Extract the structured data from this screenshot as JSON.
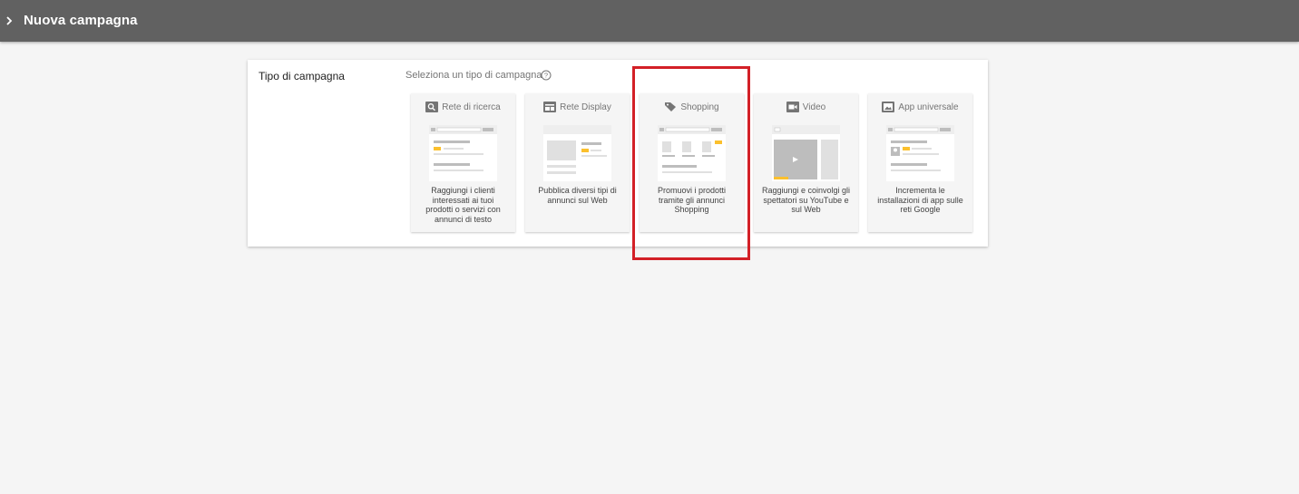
{
  "header": {
    "title": "Nuova campagna"
  },
  "section": {
    "label": "Tipo di campagna",
    "prompt": "Seleziona un tipo di campagna"
  },
  "campaign_types": [
    {
      "name": "Rete di ricerca",
      "icon": "search-icon",
      "description": "Raggiungi i clienti interessati ai tuoi prodotti o servizi con annunci di testo"
    },
    {
      "name": "Rete Display",
      "icon": "display-icon",
      "description": "Pubblica diversi tipi di annunci sul Web"
    },
    {
      "name": "Shopping",
      "icon": "tag-icon",
      "description": "Promuovi i prodotti tramite gli annunci Shopping"
    },
    {
      "name": "Video",
      "icon": "video-camera-icon",
      "description": "Raggiungi e coinvolgi gli spettatori su YouTube e sul Web"
    },
    {
      "name": "App universale",
      "icon": "app-icon",
      "description": "Incrementa le installazioni di app sulle reti Google"
    }
  ],
  "colors": {
    "topbar": "#616161",
    "background": "#f5f5f5",
    "accent_yellow": "#fbc02d",
    "highlight_red": "#d32027"
  }
}
